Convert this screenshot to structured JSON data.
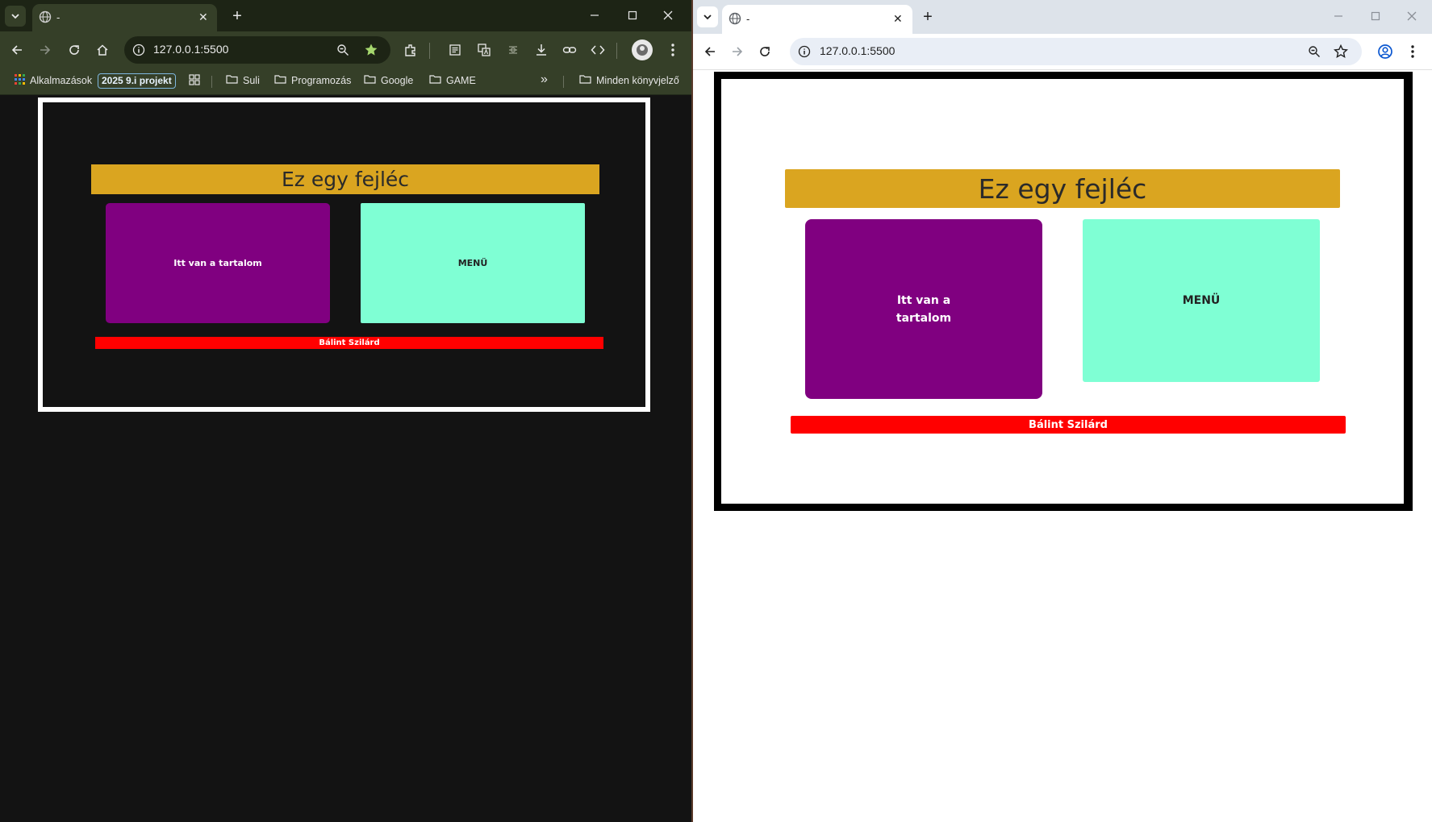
{
  "left_window": {
    "tab_title": "-",
    "url": "127.0.0.1:5500",
    "bookmarks": {
      "apps": "Alkalmazások",
      "chip": "2025 9.i projekt",
      "folders": [
        "Suli",
        "Programozás",
        "Google",
        "GAME"
      ],
      "overflow": "»",
      "all_bookmarks": "Minden könyvjelző"
    },
    "page": {
      "header": "Ez egy fejléc",
      "content": "Itt van a tartalom",
      "menu": "MENÜ",
      "footer": "Bálint Szilárd"
    }
  },
  "right_window": {
    "tab_title": "-",
    "url": "127.0.0.1:5500",
    "page": {
      "header": "Ez egy fejléc",
      "content": "Itt van a tartalom",
      "menu": "MENÜ",
      "footer": "Bálint Szilárd"
    }
  },
  "icons": {
    "tab_close": "✕",
    "new_tab": "+"
  },
  "colors": {
    "header": "#daa520",
    "content": "#800080",
    "menu": "#7fffd4",
    "footer": "#ff0000",
    "star_active": "#a6d86e"
  }
}
